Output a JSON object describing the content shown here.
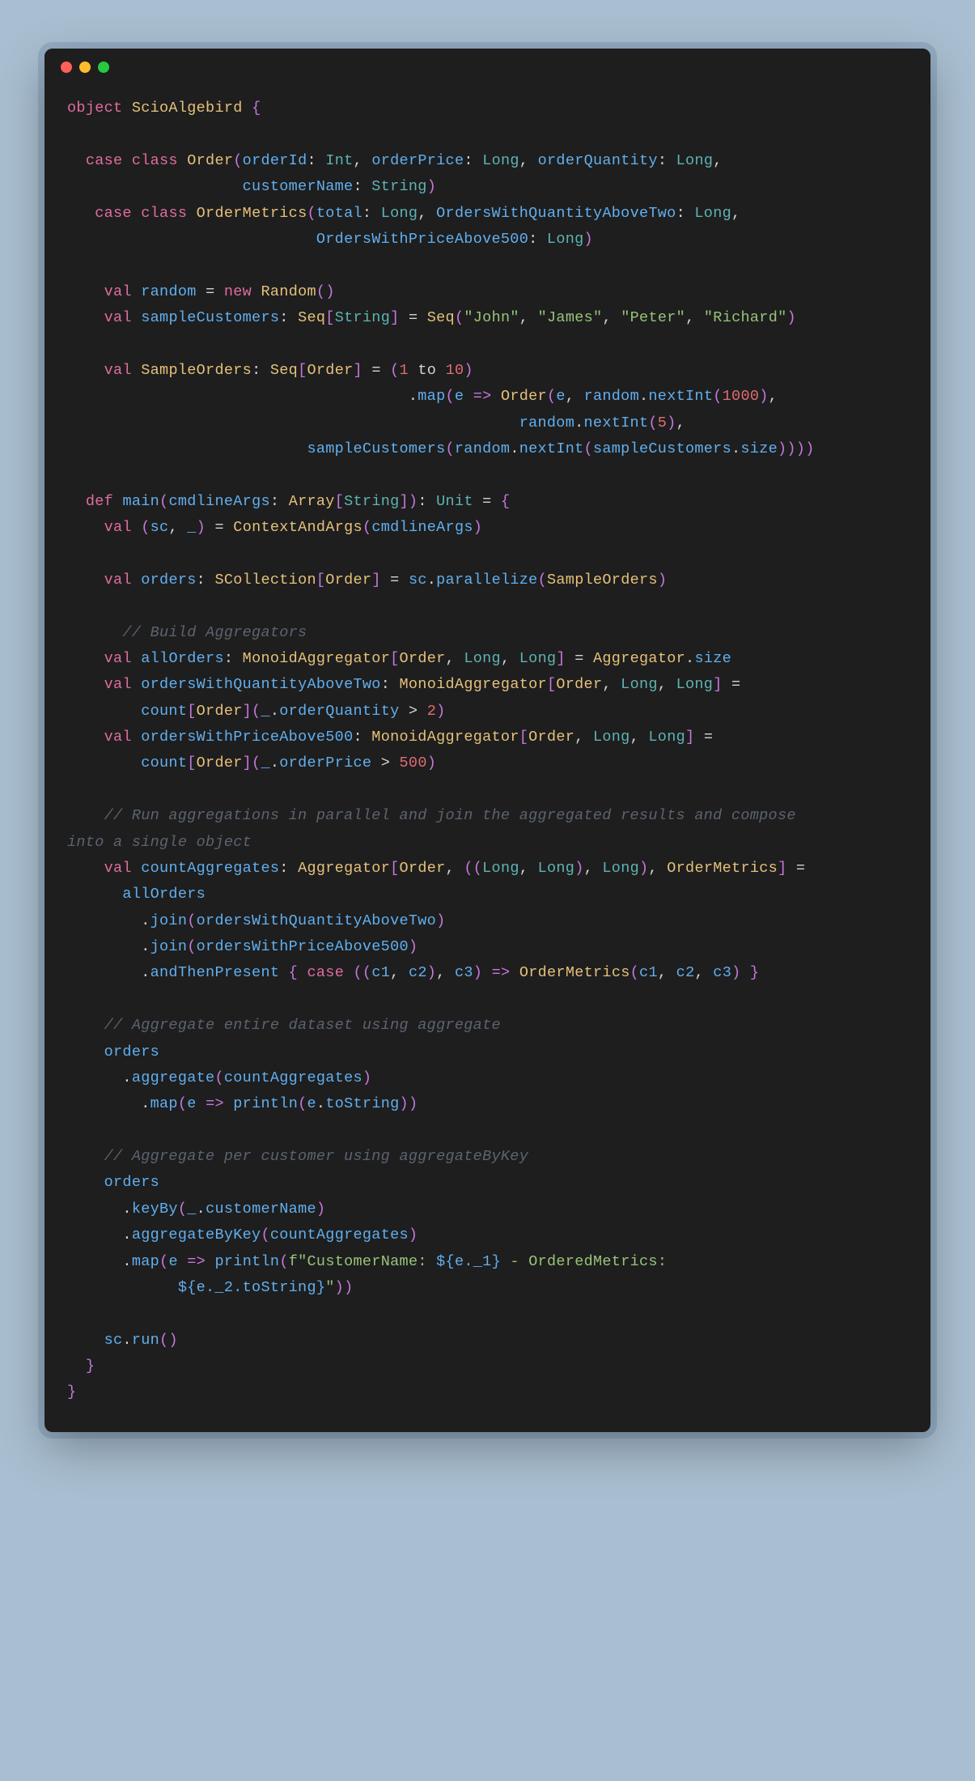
{
  "objectDecl": "object",
  "objectName": "ScioAlgebird",
  "caseClass1": {
    "kw_case": "case",
    "kw_class": "class",
    "name": "Order",
    "p1": "orderId",
    "t1": "Int",
    "p2": "orderPrice",
    "t2": "Long",
    "p3": "orderQuantity",
    "t3": "Long",
    "p4": "customerName",
    "t4": "String"
  },
  "caseClass2": {
    "kw_case": "case",
    "kw_class": "class",
    "name": "OrderMetrics",
    "p1": "total",
    "t1": "Long",
    "p2": "OrdersWithQuantityAboveTwo",
    "t2": "Long",
    "p3": "OrdersWithPriceAbove500",
    "t3": "Long"
  },
  "randomLine": {
    "kw_val": "val",
    "name": "random",
    "kw_new": "new",
    "type": "Random"
  },
  "sampleCustomers": {
    "kw_val": "val",
    "name": "sampleCustomers",
    "type": "Seq",
    "typeParam": "String",
    "ctor": "Seq",
    "v1": "\"John\"",
    "v2": "\"James\"",
    "v3": "\"Peter\"",
    "v4": "\"Richard\""
  },
  "sampleOrders": {
    "kw_val": "val",
    "name": "SampleOrders",
    "type": "Seq",
    "typeParam": "Order",
    "from": "1",
    "to_kw": "to",
    "to": "10",
    "map": "map",
    "arg": "e",
    "orderCtor": "Order",
    "nextInt": "nextInt",
    "n1": "1000",
    "n2": "5",
    "random": "random",
    "scName": "sampleCustomers",
    "size": "size"
  },
  "main": {
    "kw_def": "def",
    "name": "main",
    "param": "cmdlineArgs",
    "paramType": "Array",
    "paramTypeParam": "String",
    "returnType": "Unit"
  },
  "contextLine": {
    "kw_val": "val",
    "sc": "sc",
    "us": "_",
    "fn": "ContextAndArgs",
    "arg": "cmdlineArgs"
  },
  "ordersLine": {
    "kw_val": "val",
    "name": "orders",
    "type": "SCollection",
    "typeParam": "Order",
    "sc": "sc",
    "fn": "parallelize",
    "arg": "SampleOrders"
  },
  "comment1": "// Build Aggregators",
  "allOrders": {
    "kw_val": "val",
    "name": "allOrders",
    "type": "MonoidAggregator",
    "t1": "Order",
    "t2": "Long",
    "t3": "Long",
    "rhs1": "Aggregator",
    "rhs2": "size"
  },
  "qAboveTwo": {
    "kw_val": "val",
    "name": "ordersWithQuantityAboveTwo",
    "type": "MonoidAggregator",
    "t1": "Order",
    "t2": "Long",
    "t3": "Long",
    "fn": "count",
    "fnType": "Order",
    "field": "orderQuantity",
    "op": ">",
    "num": "2"
  },
  "pAbove500": {
    "kw_val": "val",
    "name": "ordersWithPriceAbove500",
    "type": "MonoidAggregator",
    "t1": "Order",
    "t2": "Long",
    "t3": "Long",
    "fn": "count",
    "fnType": "Order",
    "field": "orderPrice",
    "op": ">",
    "num": "500"
  },
  "comment2a": "// Run aggregations in parallel and join the aggregated results and compose",
  "comment2b": "into a single object",
  "countAgg": {
    "kw_val": "val",
    "name": "countAggregates",
    "type": "Aggregator",
    "t1": "Order",
    "t2a": "Long",
    "t2b": "Long",
    "t2c": "Long",
    "t3": "OrderMetrics",
    "allOrders": "allOrders",
    "join": "join",
    "arg1": "ordersWithQuantityAboveTwo",
    "arg2": "ordersWithPriceAbove500",
    "andThen": "andThenPresent",
    "kw_case": "case",
    "c1": "c1",
    "c2": "c2",
    "c3": "c3",
    "ctor": "OrderMetrics"
  },
  "comment3": "// Aggregate entire dataset using aggregate",
  "agg1": {
    "orders": "orders",
    "aggregate": "aggregate",
    "arg": "countAggregates",
    "map": "map",
    "e": "e",
    "println": "println",
    "toString": "toString"
  },
  "comment4": "// Aggregate per customer using aggregateByKey",
  "agg2": {
    "orders": "orders",
    "keyBy": "keyBy",
    "us": "_",
    "customerName": "customerName",
    "aggregateByKey": "aggregateByKey",
    "arg": "countAggregates",
    "map": "map",
    "e": "e",
    "println": "println",
    "fstr1": "f\"CustomerName: ",
    "interp1": "${e._1}",
    "fstr2": " - OrderedMetrics: ",
    "interp2": "${e._2.toString}",
    "fstr3": "\""
  },
  "run": {
    "sc": "sc",
    "run": "run"
  }
}
